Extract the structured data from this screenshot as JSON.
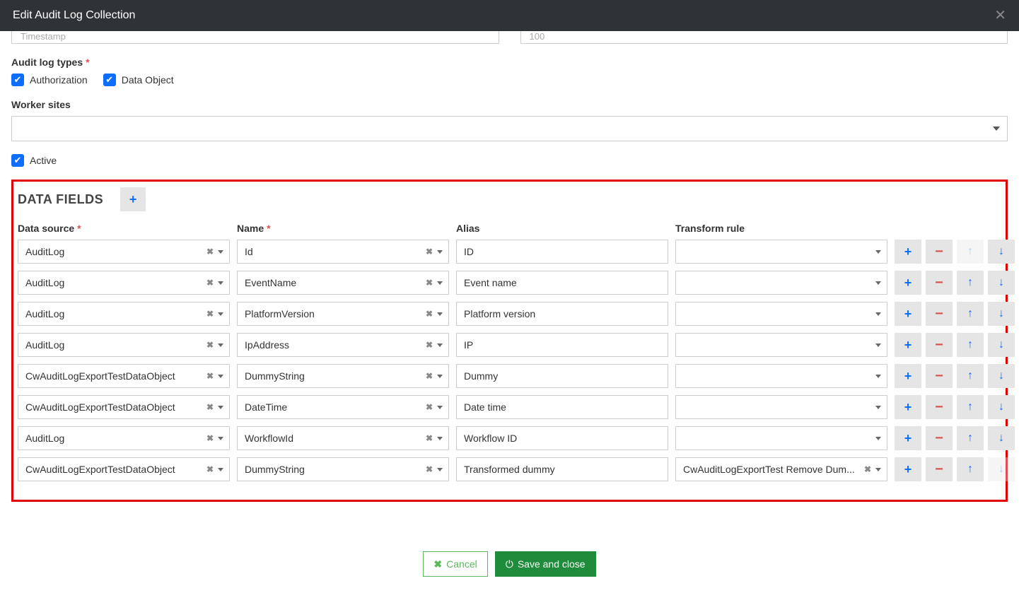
{
  "modal": {
    "title": "Edit Audit Log Collection"
  },
  "top": {
    "left_hint": "Timestamp",
    "right_hint": "100"
  },
  "labels": {
    "audit_log_types": "Audit log types",
    "authorization": "Authorization",
    "data_object": "Data Object",
    "worker_sites": "Worker sites",
    "active": "Active"
  },
  "dataFieldsSection": {
    "title": "DATA FIELDS",
    "cols": {
      "data_source": "Data source",
      "name": "Name",
      "alias": "Alias",
      "transform": "Transform rule"
    }
  },
  "rows": [
    {
      "source": "AuditLog",
      "name": "Id",
      "alias": "ID",
      "transform": "",
      "upDisabled": true,
      "downDisabled": false
    },
    {
      "source": "AuditLog",
      "name": "EventName",
      "alias": "Event name",
      "transform": "",
      "upDisabled": false,
      "downDisabled": false
    },
    {
      "source": "AuditLog",
      "name": "PlatformVersion",
      "alias": "Platform version",
      "transform": "",
      "upDisabled": false,
      "downDisabled": false
    },
    {
      "source": "AuditLog",
      "name": "IpAddress",
      "alias": "IP",
      "transform": "",
      "upDisabled": false,
      "downDisabled": false
    },
    {
      "source": "CwAuditLogExportTestDataObject",
      "name": "DummyString",
      "alias": "Dummy",
      "transform": "",
      "upDisabled": false,
      "downDisabled": false
    },
    {
      "source": "CwAuditLogExportTestDataObject",
      "name": "DateTime",
      "alias": "Date time",
      "transform": "",
      "upDisabled": false,
      "downDisabled": false
    },
    {
      "source": "AuditLog",
      "name": "WorkflowId",
      "alias": "Workflow ID",
      "transform": "",
      "upDisabled": false,
      "downDisabled": false
    },
    {
      "source": "CwAuditLogExportTestDataObject",
      "name": "DummyString",
      "alias": "Transformed dummy",
      "transform": "CwAuditLogExportTest Remove Dum...",
      "transformHasClear": true,
      "upDisabled": false,
      "downDisabled": true
    }
  ],
  "footer": {
    "cancel": "Cancel",
    "save": "Save and close"
  }
}
